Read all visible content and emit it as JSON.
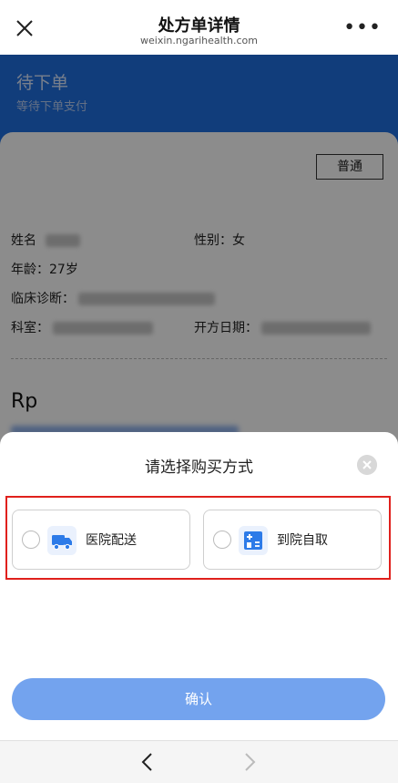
{
  "window": {
    "title": "处方单详情",
    "domain": "weixin.ngarihealth.com",
    "more": "•••"
  },
  "status": {
    "title": "待下单",
    "subtitle": "等待下单支付"
  },
  "prescription": {
    "type_tag": "普通",
    "name_label": "姓名",
    "gender_label": "性别：",
    "gender_value": "女",
    "age_label": "年龄：",
    "age_value": "27岁",
    "diagnosis_label": "临床诊断：",
    "department_label": "科室：",
    "date_label": "开方日期：",
    "rp_label": "Rp"
  },
  "sheet": {
    "title": "请选择购买方式",
    "options": [
      {
        "label": "医院配送",
        "icon": "delivery-truck-icon",
        "selected": false
      },
      {
        "label": "到院自取",
        "icon": "hospital-pickup-icon",
        "selected": false
      }
    ],
    "confirm_label": "确认"
  },
  "colors": {
    "accent": "#1f6fe0",
    "confirm": "#73a3ee",
    "highlight": "#e0201c"
  }
}
